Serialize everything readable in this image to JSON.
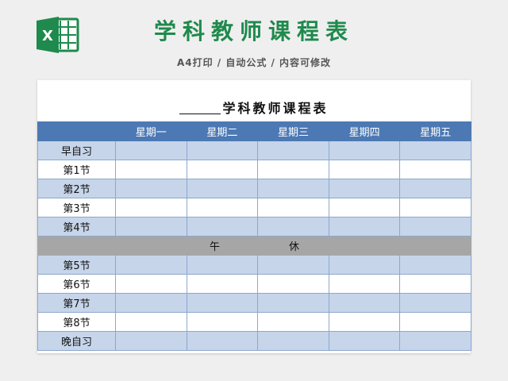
{
  "header": {
    "logo_letter": "X",
    "title": "学科教师课程表",
    "subtitle": "A4打印 / 自动公式 / 内容可修改"
  },
  "sheet": {
    "title": "学科教师课程表",
    "columns": [
      "",
      "星期一",
      "星期二",
      "星期三",
      "星期四",
      "星期五"
    ],
    "rows_morning": [
      "早自习",
      "第1节",
      "第2节",
      "第3节",
      "第4节"
    ],
    "break": {
      "left": "午",
      "right": "休"
    },
    "rows_afternoon": [
      "第5节",
      "第6节",
      "第7节",
      "第8节",
      "晚自习"
    ]
  },
  "colors": {
    "brand_green": "#1f8a4d",
    "header_blue": "#4c79b4",
    "row_shade": "#c6d5ea",
    "break_gray": "#a6a6a6"
  }
}
